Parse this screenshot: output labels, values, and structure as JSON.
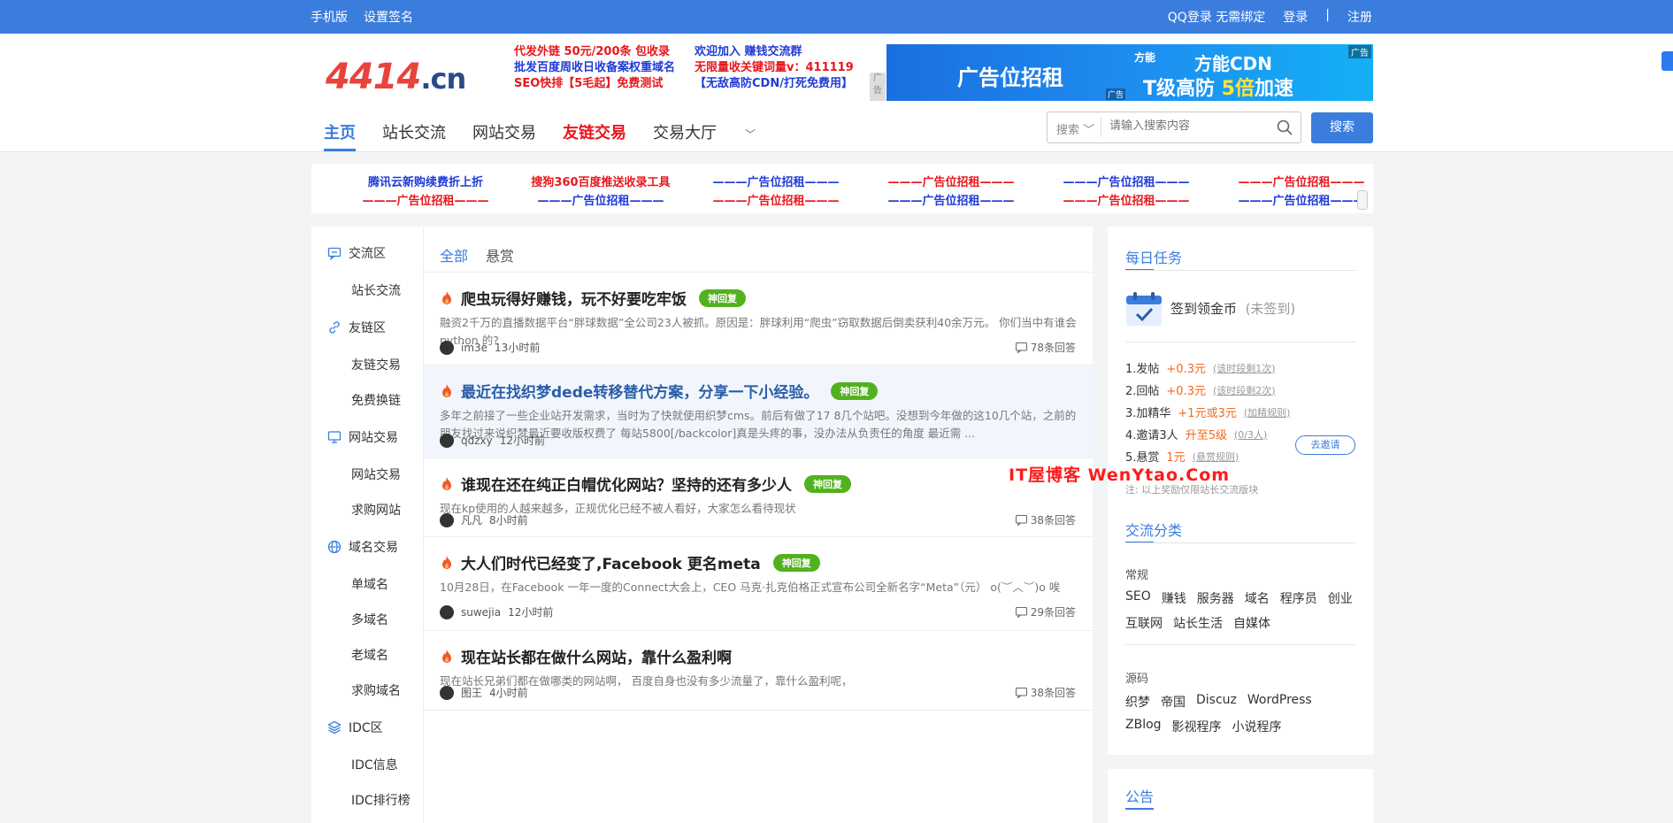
{
  "topbar": {
    "left": [
      "手机版",
      "设置签名"
    ],
    "right": [
      "QQ登录 无需绑定",
      "登录",
      "|",
      "注册"
    ]
  },
  "logo": {
    "num": "4414",
    "tld": ".cn"
  },
  "ad_text": {
    "rows": [
      [
        "代发外链 50元/200条 包收录",
        "欢迎加入 赚钱交流群"
      ],
      [
        "批发百度周收日收备案权重域名",
        "无限量收关键词量v：411119"
      ],
      [
        "SEO快排【5毛起】免费测试",
        "【无敌高防CDN/打死免费用】"
      ]
    ],
    "tag": "广告"
  },
  "cdn_ad": {
    "left": "广告位招租",
    "brand": "方能",
    "title": "方能CDN",
    "sub_a": "T级高防 ",
    "sub_b": "5倍",
    "sub_c": "加速",
    "corner": "广告",
    "corner2": "广告"
  },
  "nav": {
    "items": [
      "主页",
      "站长交流",
      "网站交易",
      "友链交易",
      "交易大厅"
    ]
  },
  "search": {
    "select": "搜索",
    "placeholder": "请输入搜索内容",
    "button": "搜索"
  },
  "flinks": {
    "items": [
      {
        "t": "腾讯云新购续费折上折",
        "c": "b"
      },
      {
        "t": "搜狗360百度推送收录工具",
        "c": "r"
      },
      {
        "t": "———广告位招租———",
        "c": "b"
      },
      {
        "t": "———广告位招租———",
        "c": "r"
      },
      {
        "t": "———广告位招租———",
        "c": "b"
      },
      {
        "t": "———广告位招租———",
        "c": "r"
      },
      {
        "t": "———广告位招租———",
        "c": "r"
      },
      {
        "t": "———广告位招租———",
        "c": "b"
      },
      {
        "t": "———广告位招租———",
        "c": "r"
      },
      {
        "t": "———广告位招租———",
        "c": "b"
      },
      {
        "t": "———广告位招租———",
        "c": "r"
      },
      {
        "t": "———广告位招租———",
        "c": "b"
      }
    ]
  },
  "sidebar": {
    "sections": [
      {
        "label": "交流区",
        "items": [
          "站长交流"
        ]
      },
      {
        "label": "友链区",
        "items": [
          "友链交易",
          "免费换链"
        ]
      },
      {
        "label": "网站交易",
        "items": [
          "网站交易",
          "求购网站"
        ]
      },
      {
        "label": "域名交易",
        "items": [
          "单域名",
          "多域名",
          "老域名",
          "求购域名"
        ]
      },
      {
        "label": "IDC区",
        "items": [
          "IDC信息",
          "IDC排行榜"
        ]
      }
    ]
  },
  "tabs": [
    "全部",
    "悬赏"
  ],
  "posts": [
    {
      "title": "爬虫玩得好赚钱，玩不好要吃牢饭",
      "badge": "神回复",
      "desc": "融资2千万的直播数据平台“胖球数据”全公司23人被抓。原因是：胖球利用“爬虫”窃取数据后倒卖获利40余万元。 你们当中有谁会 python 的?",
      "user": "im3e",
      "time": "13小时前",
      "answers": "78条回答"
    },
    {
      "title": "最近在找织梦dede转移替代方案，分享一下小经验。",
      "badge": "神回复",
      "desc": "多年之前接了一些企业站开发需求，当时为了快就使用织梦cms。前后有做了17 8几个站吧。没想到今年做的这10几个站，之前的朋友找过来说织梦最近要收版权费了 每站5800[/backcolor]真是头疼的事，没办法从负责任的角度 最近需 ...",
      "user": "qdzxy",
      "time": "12小时前",
      "answers": ""
    },
    {
      "title": "谁现在还在纯正白帽优化网站？坚持的还有多少人",
      "badge": "神回复",
      "desc": "现在kp使用的人越来越多，正规优化已经不被人看好，大家怎么看待现状",
      "user": "凡凡",
      "time": "8小时前",
      "answers": "38条回答"
    },
    {
      "title": "大人们时代已经变了,Facebook 更名meta",
      "badge": "神回复",
      "desc": "10月28日，在Facebook 一年一度的Connect大会上，CEO 马克·扎克伯格正式宣布公司全新名字“Meta”（元） o(︶︿︶)o 唉",
      "user": "suwejia",
      "time": "12小时前",
      "answers": "29条回答"
    },
    {
      "title": "现在站长都在做什么网站，靠什么盈利啊",
      "badge": "",
      "desc": "现在站长兄弟们都在做哪类的网站啊， 百度自身也没有多少流量了，靠什么盈利呢，",
      "user": "图王",
      "time": "4小时前",
      "answers": "38条回答"
    }
  ],
  "daily": {
    "title": "每日任务",
    "signin": "签到领金币",
    "signin_state": "(未签到)",
    "tasks": [
      {
        "a": "1.发帖",
        "b": "+0.3元",
        "c": "(该时段剩1次)"
      },
      {
        "a": "2.回帖",
        "b": "+0.3元",
        "c": "(该时段剩2次)"
      },
      {
        "a": "3.加精华",
        "b": "+1元或3元",
        "c": "(加精规则)"
      },
      {
        "a": "4.邀请3人",
        "b": "升至5级",
        "c": "(0/3人)"
      },
      {
        "a": "5.悬赏",
        "b": "1元",
        "c": "(悬赏规则)"
      }
    ],
    "invite": "去邀请",
    "note": "注:   以上奖励仅限站长交流版块"
  },
  "watermark": "IT屋博客  WenYtao.Com",
  "cats": {
    "title": "交流分类",
    "g1_label": "常规",
    "g1_row1": [
      "SEO",
      "赚钱",
      "服务器",
      "域名",
      "程序员",
      "创业"
    ],
    "g1_row2": [
      "互联网",
      "站长生活",
      "自媒体"
    ],
    "g2_label": "源码",
    "g2_row1": [
      "织梦",
      "帝国",
      "Discuz",
      "WordPress"
    ],
    "g2_row2": [
      "ZBlog",
      "影视程序",
      "小说程序"
    ]
  },
  "notice": {
    "title": "公告"
  },
  "colors": {
    "accent": "#3b7ddd",
    "red": "#e8171d",
    "badge": "#52b11e",
    "orange": "#f06a1d"
  }
}
